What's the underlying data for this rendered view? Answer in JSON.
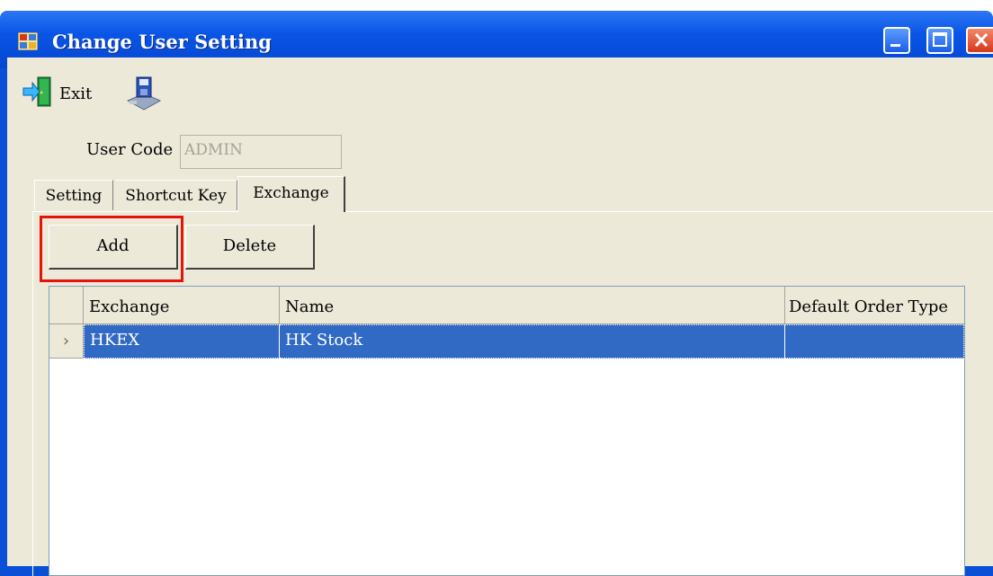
{
  "window": {
    "title": "Change User Setting",
    "colors": {
      "titlebar": "#0a55e6",
      "face": "#ece9d8",
      "selection": "#316ac5",
      "highlight_box": "#e8120c"
    }
  },
  "toolbar": {
    "exit_label": "Exit",
    "exit_icon": "exit-door-icon",
    "save_icon": "save-disk-icon"
  },
  "form": {
    "user_code_label": "User Code",
    "user_code_value": "ADMIN"
  },
  "tabs": [
    {
      "label": "Setting",
      "active": false
    },
    {
      "label": "Shortcut Key",
      "active": false
    },
    {
      "label": "Exchange",
      "active": true
    }
  ],
  "exchange_panel": {
    "add_label": "Add",
    "delete_label": "Delete",
    "table": {
      "columns": [
        "Exchange",
        "Name",
        "Default Order Type"
      ],
      "rows": [
        {
          "indicator": "›",
          "cells": [
            "HKEX",
            "HK Stock",
            ""
          ],
          "selected": true
        }
      ]
    }
  }
}
